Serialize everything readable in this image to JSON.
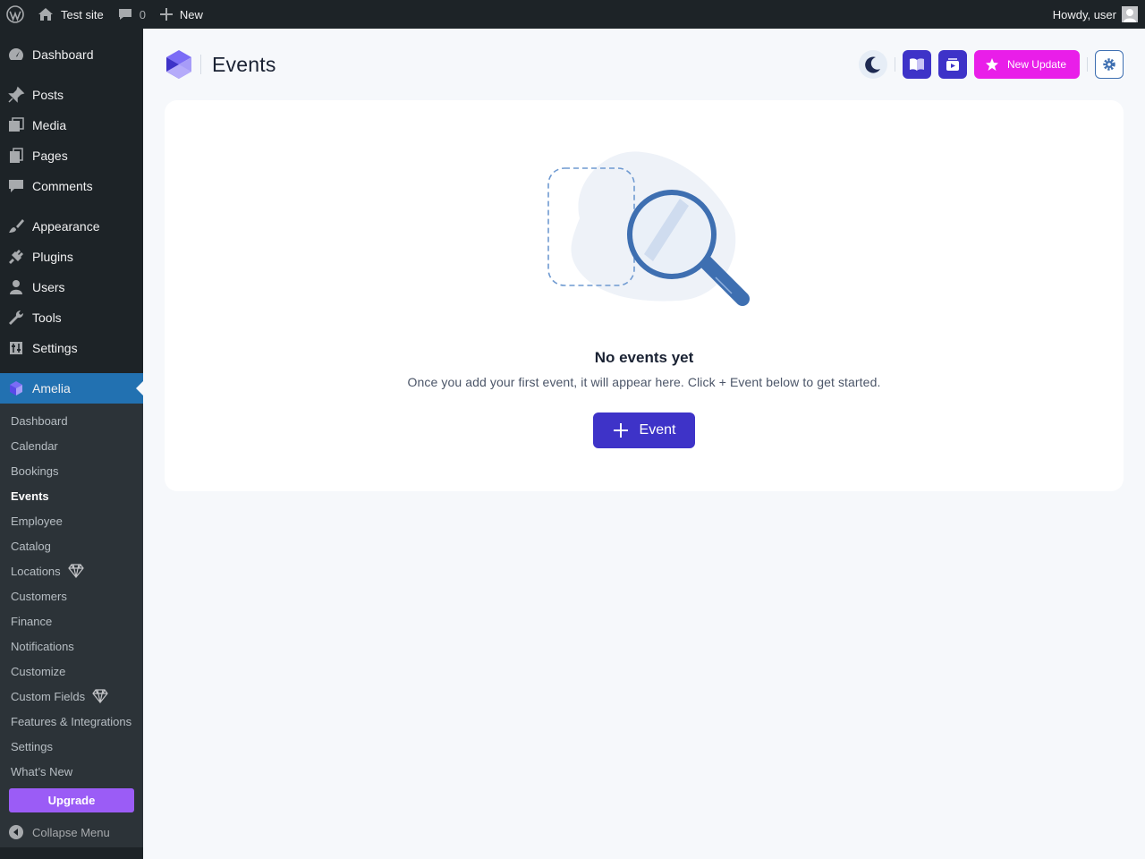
{
  "adminbar": {
    "site_name": "Test site",
    "comments_count": "0",
    "new_label": "New",
    "howdy": "Howdy, user"
  },
  "sidebar": {
    "items": [
      {
        "label": "Dashboard",
        "icon": "dashboard-icon"
      },
      {
        "label": "Posts",
        "icon": "pin-icon"
      },
      {
        "label": "Media",
        "icon": "media-icon"
      },
      {
        "label": "Pages",
        "icon": "pages-icon"
      },
      {
        "label": "Comments",
        "icon": "comment-icon"
      },
      {
        "label": "Appearance",
        "icon": "brush-icon"
      },
      {
        "label": "Plugins",
        "icon": "plug-icon"
      },
      {
        "label": "Users",
        "icon": "user-icon"
      },
      {
        "label": "Tools",
        "icon": "wrench-icon"
      },
      {
        "label": "Settings",
        "icon": "settings-icon"
      },
      {
        "label": "Amelia",
        "icon": "amelia-icon"
      }
    ],
    "submenu": [
      {
        "label": "Dashboard"
      },
      {
        "label": "Calendar"
      },
      {
        "label": "Bookings"
      },
      {
        "label": "Events"
      },
      {
        "label": "Employee"
      },
      {
        "label": "Catalog"
      },
      {
        "label": "Locations"
      },
      {
        "label": "Customers"
      },
      {
        "label": "Finance"
      },
      {
        "label": "Notifications"
      },
      {
        "label": "Customize"
      },
      {
        "label": "Custom Fields"
      },
      {
        "label": "Features & Integrations"
      },
      {
        "label": "Settings"
      },
      {
        "label": "What’s New"
      }
    ],
    "upgrade_label": "Upgrade",
    "collapse_label": "Collapse Menu"
  },
  "header": {
    "title": "Events",
    "new_update_label": "New Update"
  },
  "empty_state": {
    "title": "No events yet",
    "description": "Once you add your first event, it will appear here. Click + Event below to get started.",
    "button_label": "Event"
  },
  "colors": {
    "accent": "#3e33c8",
    "new_update": "#e91ee9",
    "wp_admin_blue": "#2271b1",
    "upgrade": "#9b5cf6"
  }
}
